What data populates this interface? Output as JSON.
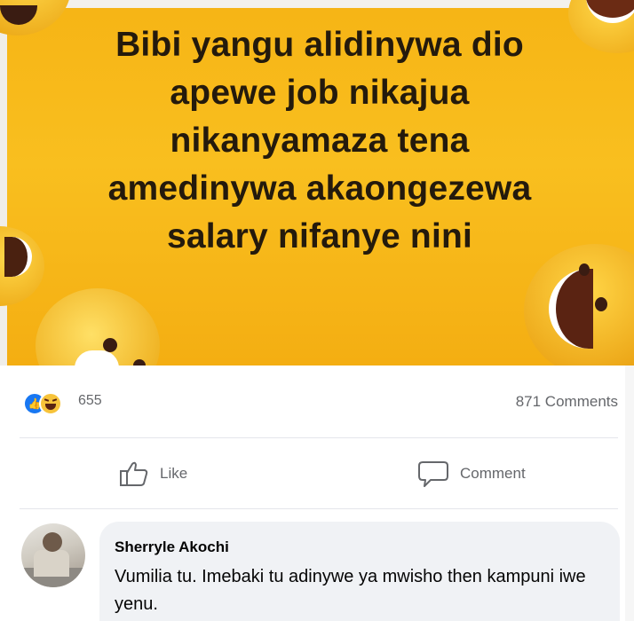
{
  "post": {
    "image_text_lines": [
      "Bibi yangu alidinywa dio",
      "apewe job nikajua",
      "nikanyamaza tena",
      "amedinywa akaongezewa",
      "salary nifanye nini"
    ],
    "background_color": "#f9bf1f"
  },
  "stats": {
    "reaction_icons": [
      "like-icon",
      "haha-icon"
    ],
    "reaction_count": "655",
    "comments_count": "871 Comments"
  },
  "actions": {
    "like_label": "Like",
    "comment_label": "Comment"
  },
  "comment": {
    "author": "Sherryle Akochi",
    "text": "Vumilia tu. Imebaki tu adinywe ya mwisho then kampuni iwe yenu."
  },
  "colors": {
    "facebook_blue": "#1877f2",
    "secondary_text": "#65676b",
    "bubble": "#f0f2f5"
  }
}
